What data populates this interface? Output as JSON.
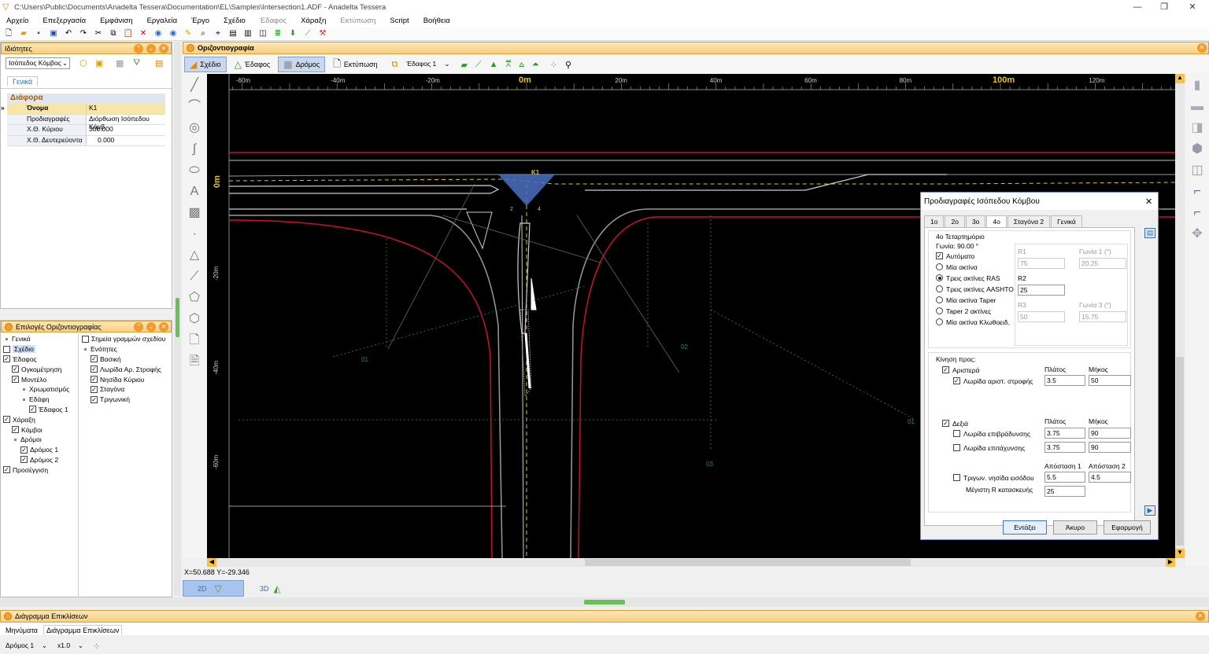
{
  "window": {
    "title": "C:\\Users\\Public\\Documents\\Anadelta Tessera\\Documentation\\EL\\Samples\\Intersection1.ADF - Anadelta Tessera",
    "min": "—",
    "max": "❐",
    "close": "✕"
  },
  "menu": {
    "items": [
      "Αρχείο",
      "Επεξεργασία",
      "Εμφάνιση",
      "Εργαλεία",
      "Έργο",
      "Σχέδιο"
    ],
    "dim_items": [
      "Έδαφος"
    ],
    "items2": [
      "Χάραξη"
    ],
    "dim2": [
      "Εκτύπωση"
    ],
    "items3": [
      "Script",
      "Βοήθεια"
    ]
  },
  "props": {
    "title": "Ιδιότητες",
    "selector": "Ισόπεδος Κόμβος",
    "tab": "Γενικά",
    "section": "Διάφορα",
    "rows": [
      {
        "k": "Όνομα",
        "v": "K1"
      },
      {
        "k": "Προδιαγραφές",
        "v": "Διόρθωση Ισόπεδου Κόμβ"
      },
      {
        "k": "Χ.Θ. Κύριου",
        "v": "300.000"
      },
      {
        "k": "Χ.Θ. Δευτερεύοντα",
        "v": "0.000"
      }
    ]
  },
  "opts": {
    "title": "Επιλογές Οριζοντιογραφίας",
    "left": [
      {
        "t": "Γενικά",
        "type": "bul",
        "i": 0
      },
      {
        "t": "Σχέδιο",
        "type": "cb",
        "c": false,
        "i": 0,
        "sel": true
      },
      {
        "t": "Έδαφος",
        "type": "cb",
        "c": true,
        "i": 0
      },
      {
        "t": "Ογκομέτρηση",
        "type": "cb",
        "c": true,
        "i": 1
      },
      {
        "t": "Μοντέλο",
        "type": "cb",
        "c": true,
        "i": 1
      },
      {
        "t": "Χρωματισμός",
        "type": "bul",
        "i": 2
      },
      {
        "t": "Εδάφη",
        "type": "bul",
        "i": 2
      },
      {
        "t": "Έδαφος 1",
        "type": "cb",
        "c": true,
        "i": 3
      },
      {
        "t": "Χάραξη",
        "type": "cb",
        "c": true,
        "i": 0
      },
      {
        "t": "Κόμβοι",
        "type": "cb",
        "c": true,
        "i": 1
      },
      {
        "t": "Δρόμοι",
        "type": "bul",
        "i": 1
      },
      {
        "t": "Δρόμος 1",
        "type": "cb",
        "c": true,
        "i": 2
      },
      {
        "t": "Δρόμος 2",
        "type": "cb",
        "c": true,
        "i": 2
      },
      {
        "t": "Προσέγγιση",
        "type": "cb",
        "c": true,
        "i": 0
      }
    ],
    "right": [
      {
        "t": "Σημεία γραμμών σχεδίου",
        "type": "cb",
        "c": false,
        "i": 0
      },
      {
        "t": "Ενότητες",
        "type": "bul",
        "i": 0
      },
      {
        "t": "Βασική",
        "type": "cb",
        "c": true,
        "i": 1
      },
      {
        "t": "Λωρίδα Αρ. Στροφής",
        "type": "cb",
        "c": true,
        "i": 1
      },
      {
        "t": "Νησίδα Κύριου",
        "type": "cb",
        "c": true,
        "i": 1
      },
      {
        "t": "Σταγόνα",
        "type": "cb",
        "c": true,
        "i": 1
      },
      {
        "t": "Τριγωνική",
        "type": "cb",
        "c": true,
        "i": 1
      }
    ]
  },
  "main": {
    "title": "Οριζοντιογραφία",
    "tabs": [
      "Σχέδιο",
      "Έδαφος",
      "Δρόμος",
      "Εκτύπωση"
    ],
    "ground": "Έδαφος 1"
  },
  "ruler": {
    "x": [
      {
        "t": "-60m",
        "v": -60
      },
      {
        "t": "-40m",
        "v": -40
      },
      {
        "t": "-20m",
        "v": -20
      },
      {
        "t": "0m",
        "v": 0
      },
      {
        "t": "20m",
        "v": 20
      },
      {
        "t": "40m",
        "v": 40
      },
      {
        "t": "60m",
        "v": 60
      },
      {
        "t": "80m",
        "v": 80
      },
      {
        "t": "100m",
        "v": 100
      },
      {
        "t": "120m",
        "v": 120
      }
    ],
    "y": [
      "0m",
      "-20m",
      "-40m",
      "-60m"
    ]
  },
  "drawing": {
    "node": "K1",
    "n2": "2",
    "n4": "4",
    "o1a": "01",
    "o2": "02",
    "o3": "03",
    "o1b": "01"
  },
  "coords": "X=50.688  Y=-29.346",
  "views": {
    "v2d": "2D",
    "v3d": "3D"
  },
  "dialog": {
    "title": "Προδιαγραφές Ισόπεδου Κόμβου",
    "tabs": [
      "1ο",
      "2ο",
      "3ο",
      "4ο",
      "Σταγόνα 2",
      "Γενικά"
    ],
    "quadrant": "4ο Τεταρτημόριο",
    "angle": "Γωνία: 90.00 °",
    "auto": "Αυτόματο",
    "radios": [
      "Μία ακτίνα",
      "Τρεις ακτίνες RAS",
      "Τρεις ακτίνες AASHTO",
      "Μία ακτίνα Taper",
      "Taper 2 ακτίνες",
      "Μία ακτίνα Κλωθοειδ."
    ],
    "r1": "R1",
    "r1v": "75",
    "g1": "Γωνία 1 (°)",
    "g1v": "20.25",
    "r2": "R2",
    "r2v": "25",
    "r3": "R3",
    "r3v": "50",
    "g3": "Γωνία 3 (°)",
    "g3v": "15.75",
    "move": "Κίνηση προς:",
    "width": "Πλάτος",
    "length": "Μήκος",
    "left": "Αριστερά",
    "leftlane": "Λωρίδα αριστ. στροφής",
    "llw": "3.5",
    "lll": "50",
    "right": "Δεξιά",
    "decel": "Λωρίδα επιβράδυνσης",
    "decw": "3.75",
    "decl": "90",
    "accel": "Λωρίδα επιτάχυνσης",
    "accw": "3.75",
    "accl": "90",
    "d1": "Απόσταση 1",
    "d2": "Απόσταση 2",
    "tri": "Τριγων. νησίδα εισόδου",
    "triv1": "5.5",
    "triv2": "4.5",
    "maxr": "Μέγιστη R κατασκευής",
    "maxrv": "25",
    "ok": "Εντάξει",
    "cancel": "Άκυρο",
    "apply": "Εφαρμογή",
    "close": "✕"
  },
  "bottom": {
    "title": "Διάγραμμα Επικλίσεων",
    "tabs": [
      "Μηνύματα",
      "Διάγραμμα Επικλίσεων"
    ],
    "road": "Δρόμος 1",
    "zoom": "x1.0"
  },
  "colors": {
    "accent": "#f39a2c",
    "red": "#c8102e",
    "yellow": "#e6c419"
  }
}
